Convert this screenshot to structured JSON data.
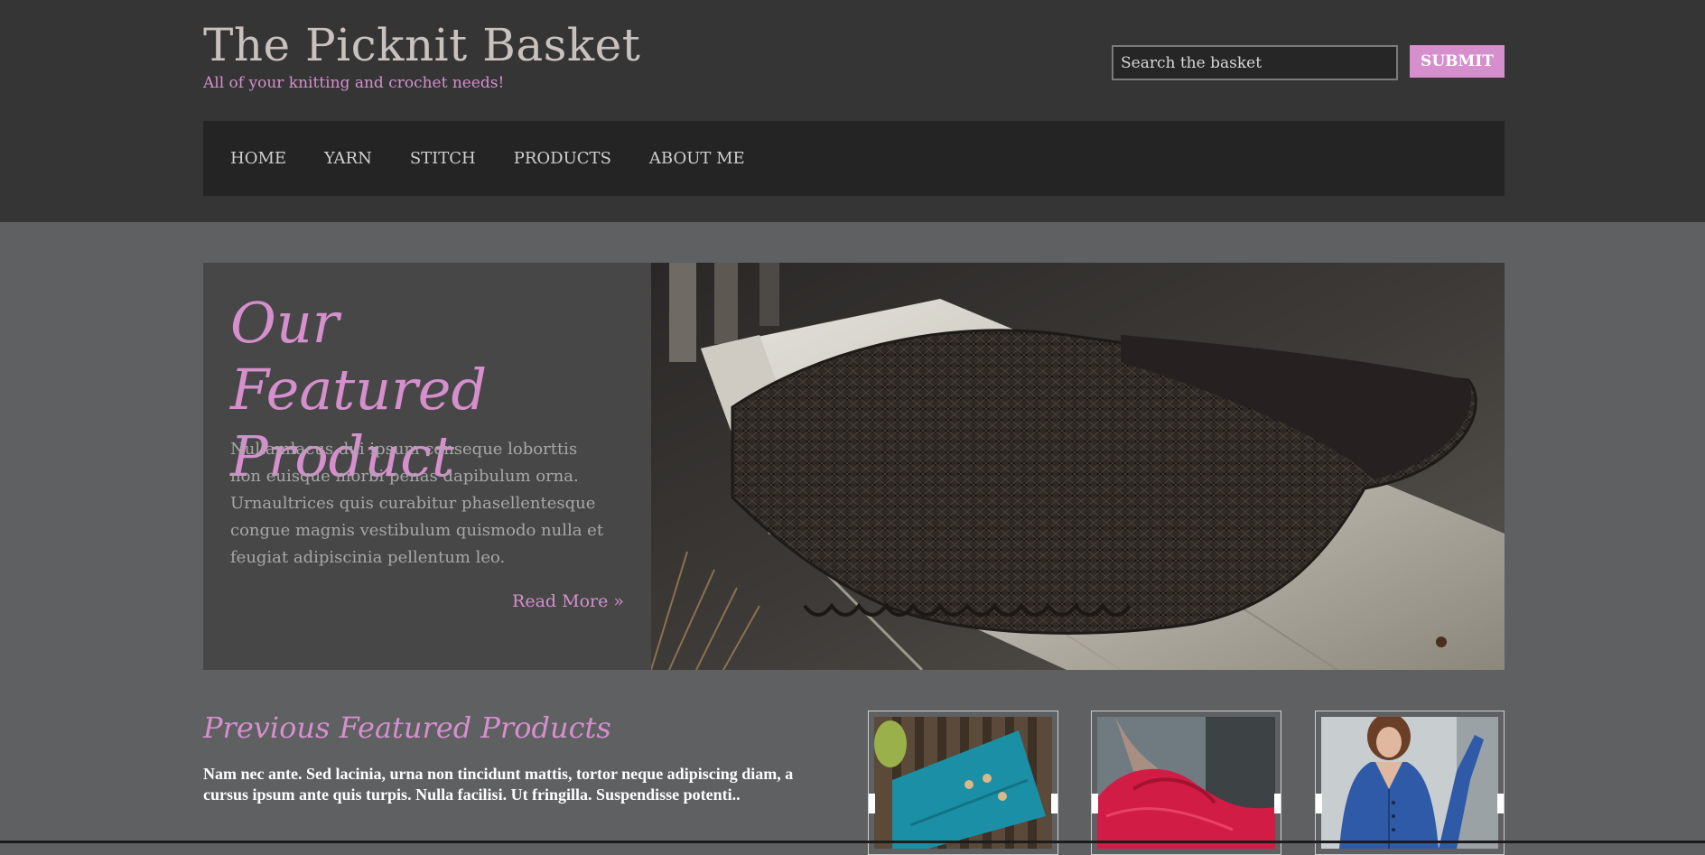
{
  "header": {
    "site_title": "The Picknit Basket",
    "tagline": "All of your knitting and crochet needs!",
    "search": {
      "placeholder": "Search the basket",
      "value": ""
    },
    "submit_label": "SUBMIT"
  },
  "nav": {
    "items": [
      {
        "label": "HOME"
      },
      {
        "label": "YARN"
      },
      {
        "label": "STITCH"
      },
      {
        "label": "PRODUCTS"
      },
      {
        "label": "ABOUT ME"
      }
    ]
  },
  "featured": {
    "heading": "Our Featured Product",
    "text": "Nullamlacus dui ipsum conseque loborttis non euisque morbi penas dapibulum orna. Urnaultrices quis curabitur phasellentesque congue magnis vestibulum quismodo nulla et feugiat adipiscinia pellentum leo.",
    "read_more": "Read More »"
  },
  "previous": {
    "heading": "Previous Featured Products",
    "text": "Nam nec ante. Sed lacinia, urna non tincidunt mattis, tortor neque adipiscing diam, a cursus ipsum ante quis turpis. Nulla facilisi. Ut fringilla. Suspendisse potenti.."
  },
  "colors": {
    "accent": "#d58fcd",
    "header_bg": "#353535",
    "nav_bg": "#242424",
    "page_bg": "#5f6062",
    "panel_bg": "#474747"
  }
}
